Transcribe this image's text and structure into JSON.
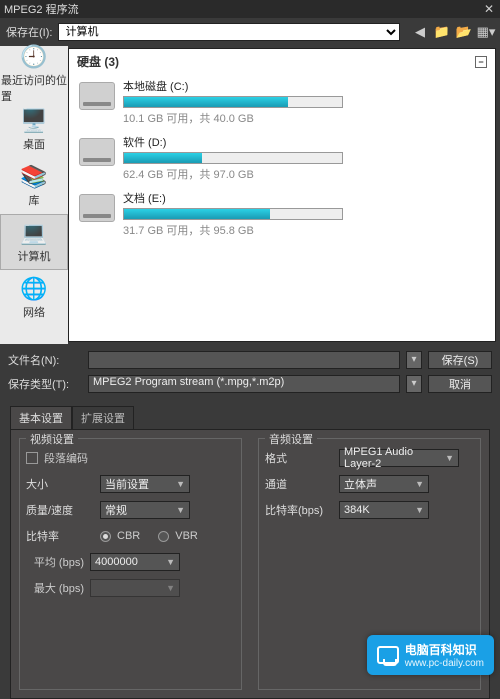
{
  "title": "MPEG2 程序流",
  "save_in_label": "保存在(I):",
  "save_in_value": "计算机",
  "topbar_icons": [
    "back-icon",
    "up-icon",
    "new-folder-icon",
    "view-icon"
  ],
  "leftbar": {
    "items": [
      {
        "label": "最近访问的位置",
        "icon": "🕘"
      },
      {
        "label": "桌面",
        "icon": "🖥️"
      },
      {
        "label": "库",
        "icon": "📚"
      },
      {
        "label": "计算机",
        "icon": "💻",
        "selected": true
      },
      {
        "label": "网络",
        "icon": "🌐"
      }
    ]
  },
  "browser": {
    "header": "硬盘 (3)",
    "drives": [
      {
        "name": "本地磁盘 (C:)",
        "info": "10.1 GB 可用，共 40.0 GB",
        "pct": 75
      },
      {
        "name": "软件 (D:)",
        "info": "62.4 GB 可用，共 97.0 GB",
        "pct": 36
      },
      {
        "name": "文档 (E:)",
        "info": "31.7 GB 可用，共 95.8 GB",
        "pct": 67
      }
    ]
  },
  "form": {
    "filename_label": "文件名(N):",
    "filename_value": "",
    "type_label": "保存类型(T):",
    "type_value": "MPEG2 Program stream (*.mpg,*.m2p)",
    "save_btn": "保存(S)",
    "cancel_btn": "取消"
  },
  "tabs": {
    "active": "基本设置",
    "inactive": "扩展设置"
  },
  "video": {
    "legend": "视频设置",
    "segment_label": "段落编码",
    "size_label": "大小",
    "size_value": "当前设置",
    "qs_label": "质量/速度",
    "qs_value": "常规",
    "bitrate_label": "比特率",
    "cbr": "CBR",
    "vbr": "VBR",
    "avg_label": "平均 (bps)",
    "avg_value": "4000000",
    "max_label": "最大 (bps)",
    "max_value": ""
  },
  "audio": {
    "legend": "音频设置",
    "fmt_label": "格式",
    "fmt_value": "MPEG1 Audio Layer-2",
    "ch_label": "通道",
    "ch_value": "立体声",
    "br_label": "比特率(bps)",
    "br_value": "384K"
  },
  "watermark": {
    "t1": "电脑百科知识",
    "t2": "www.pc-daily.com"
  }
}
